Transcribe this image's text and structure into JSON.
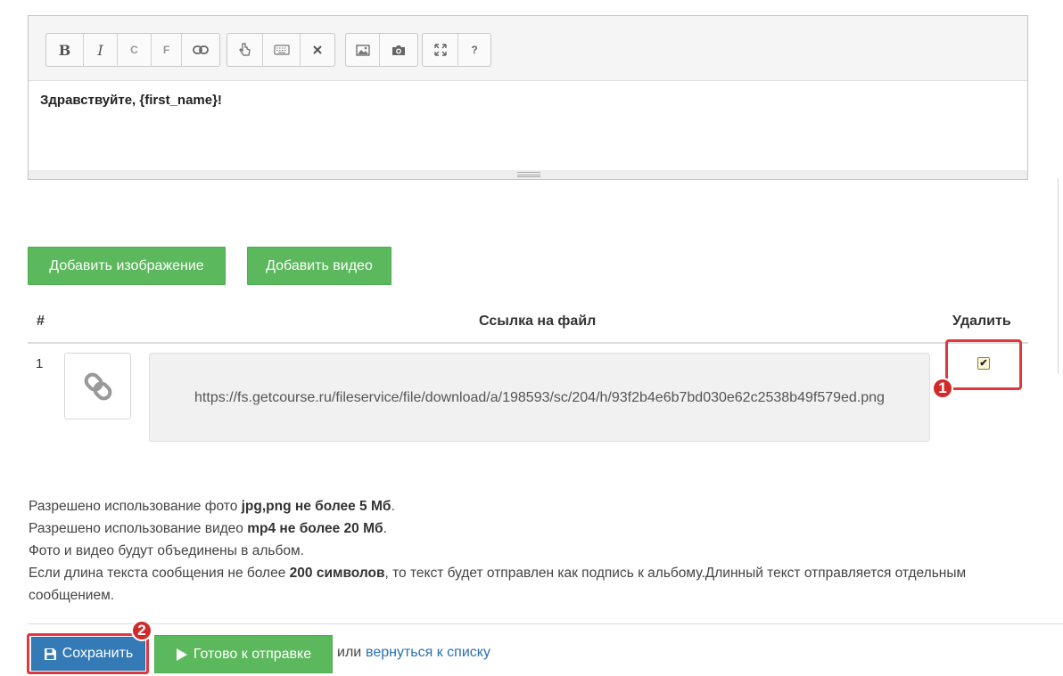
{
  "editor": {
    "toolbar": {
      "bold": "B",
      "italic": "I",
      "code": "C",
      "format": "F",
      "link_icon": "link-icon",
      "pointer_icon": "pointer-hand-icon",
      "keyboard_icon": "keyboard-icon",
      "clear_icon": "close-icon",
      "image_icon": "image-icon",
      "camera_icon": "camera-icon",
      "fullscreen_icon": "expand-icon",
      "help": "?"
    },
    "content": "Здравствуйте, {first_name}!"
  },
  "media_buttons": {
    "add_image": "Добавить изображение",
    "add_video": "Добавить видео"
  },
  "table": {
    "headers": {
      "num": "#",
      "link": "Ссылка на файл",
      "delete": "Удалить"
    },
    "rows": [
      {
        "num": "1",
        "thumb_icon": "chain-link-icon",
        "url": "https://fs.getcourse.ru/fileservice/file/download/a/198593/sc/204/h/93f2b4e6b7bd030e62c2538b49f579ed.png",
        "delete_checked": true
      }
    ]
  },
  "info": {
    "l1_pre": "Разрешено использование фото ",
    "l1_bold": "jpg,png не более 5 Мб",
    "l1_post": ".",
    "l2_pre": "Разрешено использование видео ",
    "l2_bold": "mp4 не более 20 Мб",
    "l2_post": ".",
    "l3": "Фото и видео будут объединены в альбом.",
    "l4_pre": "Если длина текста сообщения не более ",
    "l4_bold": "200 символов",
    "l4_post": ", то текст будет отправлен как подпись к альбому.Длинный текст отправляется отдельным сообщением."
  },
  "actions": {
    "save": "Сохранить",
    "ready": "Готово к отправке",
    "or": "или",
    "back": "вернуться к списку"
  },
  "markers": {
    "m1": "1",
    "m2": "2"
  },
  "colors": {
    "green": "#5cb85c",
    "blue": "#337ab7",
    "highlight_red": "#e0383e",
    "link": "#2a6fb5"
  }
}
